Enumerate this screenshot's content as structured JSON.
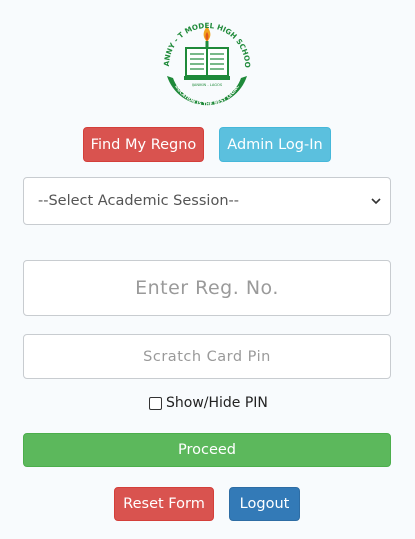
{
  "logo": {
    "top_text": "DANNY - T MODEL HIGH SCHOOL",
    "location": "IJANIKIN - LAGOS",
    "motto": "EDUCATION IS THE BEST LEGACY",
    "icon": "open-book-with-torch"
  },
  "buttons": {
    "find_regno": "Find My Regno",
    "admin_login": "Admin Log-In",
    "proceed": "Proceed",
    "reset": "Reset Form",
    "logout": "Logout"
  },
  "session_select": {
    "value": "--Select Academic Session--"
  },
  "inputs": {
    "reg_placeholder": "Enter Reg. No.",
    "pin_placeholder": "Scratch Card Pin"
  },
  "show_hide": {
    "label": "Show/Hide PIN",
    "checked": false
  },
  "colors": {
    "red": "#d9534f",
    "cyan": "#5bc0de",
    "green": "#5cb85c",
    "blue": "#337ab7",
    "logo_green": "#1f8a3a"
  }
}
